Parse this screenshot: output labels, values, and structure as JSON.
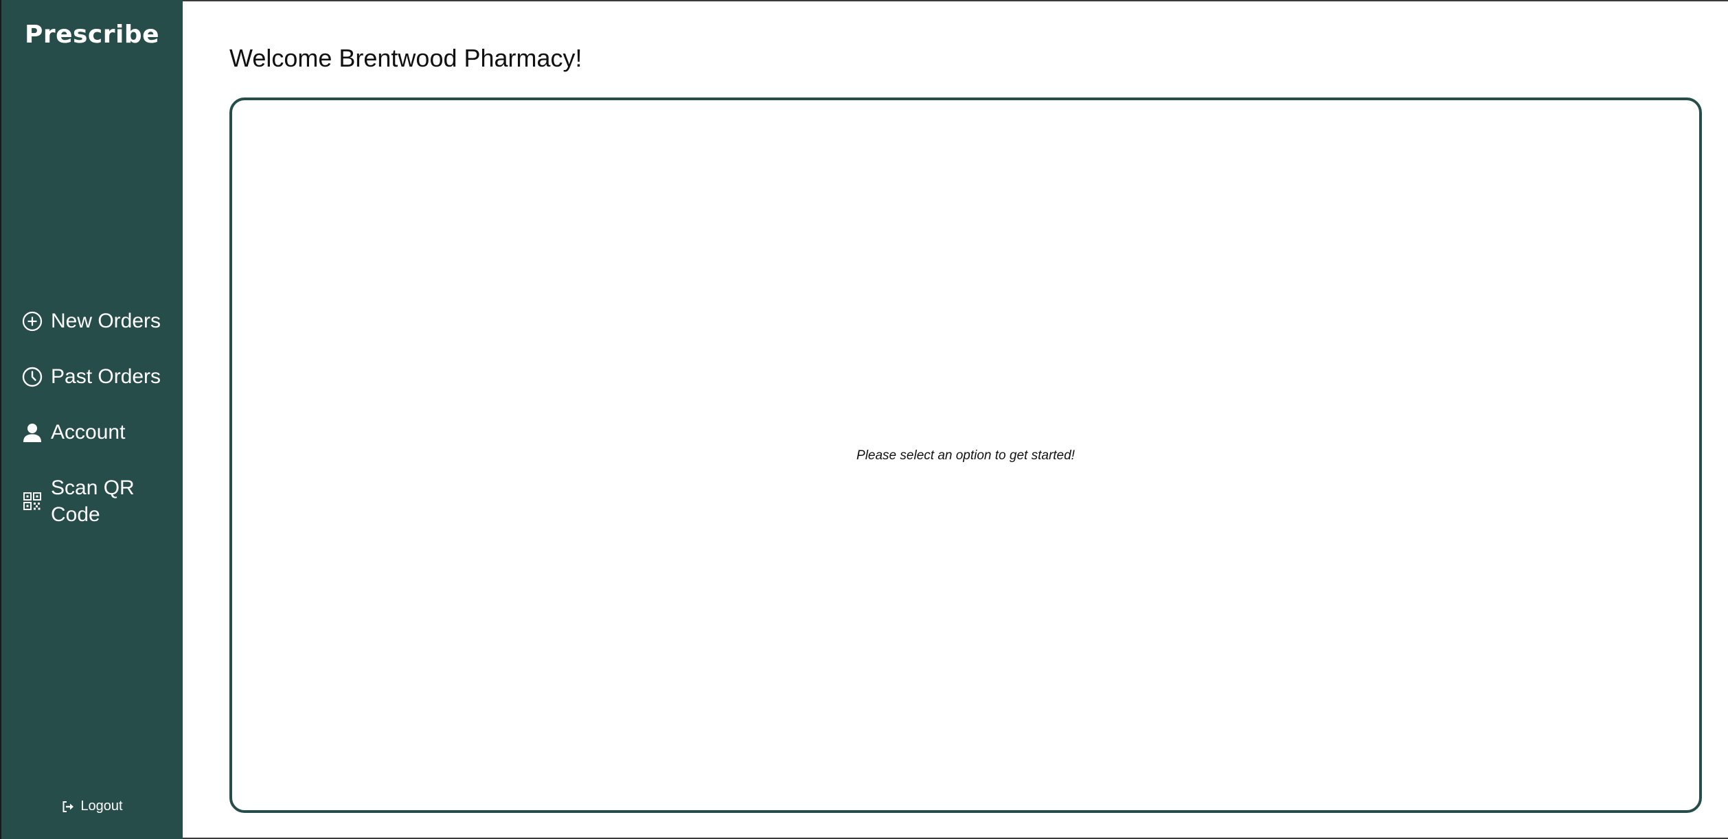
{
  "sidebar": {
    "brand": "Prescribe",
    "items": [
      {
        "label": "New Orders",
        "icon": "plus-circle-icon"
      },
      {
        "label": "Past Orders",
        "icon": "clock-icon"
      },
      {
        "label": "Account",
        "icon": "user-icon"
      },
      {
        "label": "Scan QR Code",
        "icon": "qr-code-icon"
      }
    ],
    "logout_label": "Logout",
    "logout_icon": "logout-icon",
    "background_color": "#264d4a"
  },
  "main": {
    "title": "Welcome Brentwood Pharmacy!",
    "empty_message": "Please select an option to get started!",
    "panel_border_color": "#264d4a"
  }
}
